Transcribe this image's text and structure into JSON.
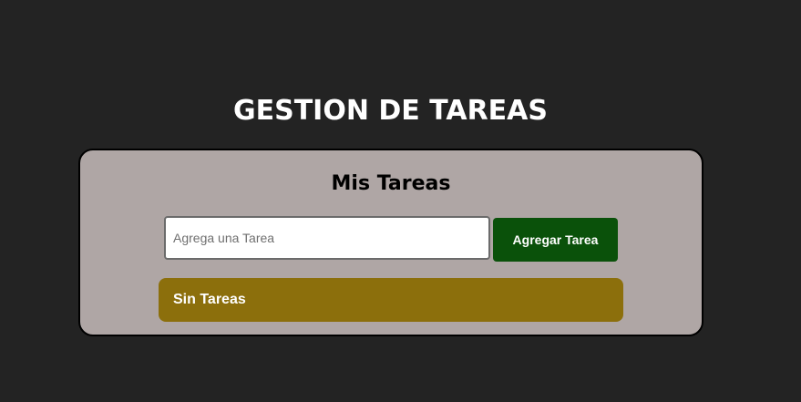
{
  "header": {
    "title": "GESTION DE TAREAS"
  },
  "card": {
    "title": "Mis Tareas",
    "input": {
      "value": "",
      "placeholder": "Agrega una Tarea"
    },
    "add_button_label": "Agregar Tarea",
    "empty_message": "Sin Tareas"
  },
  "colors": {
    "background": "#232323",
    "card": "#afa6a5",
    "add_button": "#0a510a",
    "empty_state": "#8c6f0c"
  }
}
